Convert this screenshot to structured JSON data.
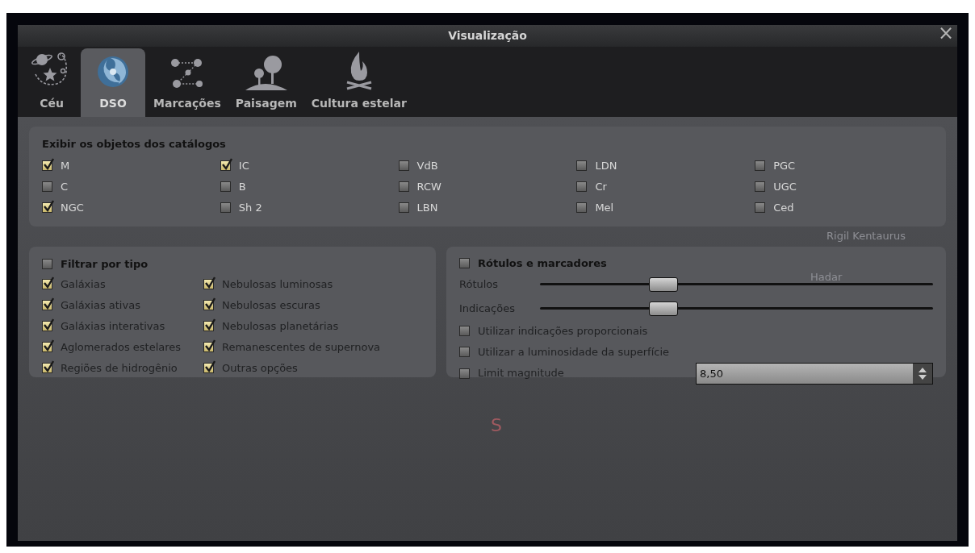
{
  "window": {
    "title": "Visualização",
    "close": "×"
  },
  "tabs": [
    {
      "label": "Céu",
      "selected": false
    },
    {
      "label": "DSO",
      "selected": true
    },
    {
      "label": "Marcações",
      "selected": false
    },
    {
      "label": "Paisagem",
      "selected": false
    },
    {
      "label": "Cultura estelar",
      "selected": false
    }
  ],
  "catalogs": {
    "title": "Exibir os objetos dos catálogos",
    "columns": [
      [
        {
          "label": "M",
          "checked": true
        },
        {
          "label": "C",
          "checked": false
        },
        {
          "label": "NGC",
          "checked": true
        }
      ],
      [
        {
          "label": "IC",
          "checked": true
        },
        {
          "label": "B",
          "checked": false
        },
        {
          "label": "Sh 2",
          "checked": false
        }
      ],
      [
        {
          "label": "VdB",
          "checked": false
        },
        {
          "label": "RCW",
          "checked": false
        },
        {
          "label": "LBN",
          "checked": false
        }
      ],
      [
        {
          "label": "LDN",
          "checked": false
        },
        {
          "label": "Cr",
          "checked": false
        },
        {
          "label": "Mel",
          "checked": false
        }
      ],
      [
        {
          "label": "PGC",
          "checked": false
        },
        {
          "label": "UGC",
          "checked": false
        },
        {
          "label": "Ced",
          "checked": false
        }
      ]
    ]
  },
  "filter": {
    "title": "Filtrar por tipo",
    "checked": false,
    "columns": [
      [
        {
          "label": "Galáxias",
          "checked": true,
          "disabled": true
        },
        {
          "label": "Galáxias ativas",
          "checked": true,
          "disabled": true
        },
        {
          "label": "Galáxias interativas",
          "checked": true,
          "disabled": true
        },
        {
          "label": "Aglomerados estelares",
          "checked": true,
          "disabled": true
        },
        {
          "label": "Regiões de hidrogênio",
          "checked": true,
          "disabled": true
        }
      ],
      [
        {
          "label": "Nebulosas luminosas",
          "checked": true,
          "disabled": true
        },
        {
          "label": "Nebulosas escuras",
          "checked": true,
          "disabled": true
        },
        {
          "label": "Nebulosas planetárias",
          "checked": true,
          "disabled": true
        },
        {
          "label": "Remanescentes de supernova",
          "checked": true,
          "disabled": true
        },
        {
          "label": "Outras opções",
          "checked": true,
          "disabled": true
        }
      ]
    ]
  },
  "labels": {
    "title": "Rótulos e marcadores",
    "checked": false,
    "sliders": [
      {
        "label": "Rótulos",
        "level": 0.3,
        "disabled": true
      },
      {
        "label": "Indicações",
        "level": 0.3,
        "disabled": true
      }
    ],
    "options": [
      {
        "label": "Utilizar indicações proporcionais",
        "checked": false,
        "disabled": true
      },
      {
        "label": "Utilizar a luminosidade da superfície",
        "checked": false,
        "disabled": true
      }
    ],
    "limit": {
      "label": "Limit magnitude",
      "checked": false,
      "disabled": true,
      "value": "8,50"
    }
  },
  "sky_labels": [
    {
      "text": "Rigil Kentaurus",
      "kind": "star"
    },
    {
      "text": "Hadar",
      "kind": "star"
    },
    {
      "text": "S",
      "kind": "cardinal"
    }
  ]
}
